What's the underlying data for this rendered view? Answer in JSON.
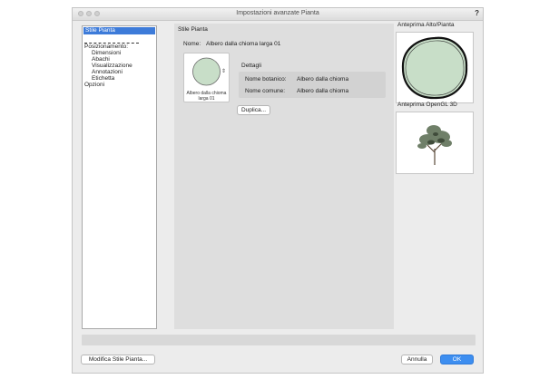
{
  "window": {
    "title": "Impostazioni avanzate Pianta",
    "help": "?"
  },
  "sidebar": {
    "items": [
      {
        "label": "Stile Pianta",
        "selected": true
      },
      {
        "label": "Posizionamento:"
      },
      {
        "label": "Dimensioni"
      },
      {
        "label": "Abachi"
      },
      {
        "label": "Visualizzazione"
      },
      {
        "label": "Annotazioni"
      },
      {
        "label": "Etichetta"
      },
      {
        "label": "Opzioni"
      }
    ]
  },
  "center": {
    "section_title": "Stile Pianta",
    "name_label": "Nome:",
    "name_value": "Albero dalla chioma larga 01",
    "thumbnail_caption": "Albero dalla chioma larga 01",
    "details_title": "Dettagli",
    "botanical_label": "Nome botanico:",
    "botanical_value": "Albero dalla chioma",
    "common_label": "Nome comune:",
    "common_value": "Albero dalla chioma",
    "duplicate_button": "Duplica..."
  },
  "right": {
    "top_preview_title": "Anteprima Alto/Pianta",
    "opengl_preview_title": "Anteprima OpenGL 3D"
  },
  "footer": {
    "modify_button": "Modifica Stile Pianta...",
    "cancel_button": "Annulla",
    "ok_button": "OK"
  },
  "colors": {
    "selection": "#3d7bd9",
    "primary_button": "#3d8ef0",
    "canopy": "#c8dec8"
  }
}
